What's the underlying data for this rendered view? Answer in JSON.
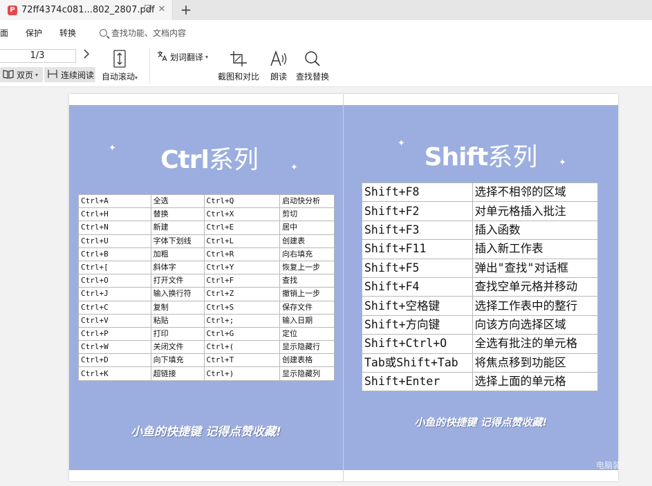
{
  "tab": {
    "title": "72ff4374c081...802_2807.pdf",
    "pdf_badge": "P"
  },
  "menu": {
    "items": [
      "面",
      "保护",
      "转换"
    ],
    "search_placeholder": "查找功能、文档内容"
  },
  "toolbar": {
    "page_value": "1/3",
    "dual_page_label": "双页",
    "continuous_label": "连续阅读",
    "auto_scroll_label": "自动滚动",
    "translate_label": "划词翻译",
    "screenshot_label": "截图和对比",
    "read_aloud_label": "朗读",
    "find_replace_label": "查找替换"
  },
  "left_page": {
    "heading_latin": "Ctrl",
    "heading_cjk": "系列",
    "rows": [
      [
        "Ctrl+A",
        "全选",
        "Ctrl+Q",
        "启动快分析"
      ],
      [
        "Ctrl+H",
        "替换",
        "Ctrl+X",
        "剪切"
      ],
      [
        "Ctrl+N",
        "新建",
        "Ctrl+E",
        "居中"
      ],
      [
        "Ctrl+U",
        "字体下划线",
        "Ctrl+L",
        "创建表"
      ],
      [
        "Ctrl+B",
        "加粗",
        "Ctrl+R",
        "向右填充"
      ],
      [
        "Ctrl+[",
        "斜体字",
        "Ctrl+Y",
        "恢复上一步"
      ],
      [
        "Ctrl+O",
        "打开文件",
        "Ctrl+F",
        "查找"
      ],
      [
        "Ctrl+J",
        "输入换行符",
        "Ctrl+Z",
        "撤销上一步"
      ],
      [
        "Ctrl+C",
        "复制",
        "Ctrl+S",
        "保存文件"
      ],
      [
        "Ctrl+V",
        "粘贴",
        "Ctrl+;",
        "输入日期"
      ],
      [
        "Ctrl+P",
        "打印",
        "Ctrl+G",
        "定位"
      ],
      [
        "Ctrl+W",
        "关闭文件",
        "Ctrl+(",
        "显示隐藏行"
      ],
      [
        "Ctrl+D",
        "向下填充",
        "Ctrl+T",
        "创建表格"
      ],
      [
        "Ctrl+K",
        "超链接",
        "Ctrl+)",
        "显示隐藏列"
      ]
    ],
    "footer": "小鱼的快捷键 记得点赞收藏!"
  },
  "right_page": {
    "heading_latin": "Shift",
    "heading_cjk": "系列",
    "rows": [
      [
        "Shift+F8",
        "选择不相邻的区域"
      ],
      [
        "Shift+F2",
        "对单元格插入批注"
      ],
      [
        "Shift+F3",
        "插入函数"
      ],
      [
        "Shift+F11",
        "插入新工作表"
      ],
      [
        "Shift+F5",
        "弹出\"查找\"对话框"
      ],
      [
        "Shift+F4",
        "查找空单元格并移动"
      ],
      [
        "Shift+空格键",
        "选择工作表中的整行"
      ],
      [
        "Shift+方向键",
        "向该方向选择区域"
      ],
      [
        "Shift+Ctrl+O",
        "全选有批注的单元格"
      ],
      [
        "Tab或Shift+Tab",
        "将焦点移到功能区"
      ],
      [
        "Shift+Enter",
        "选择上面的单元格"
      ]
    ],
    "footer": "小鱼的快捷键 记得点赞收藏!"
  },
  "watermark": "电脑装",
  "colors": {
    "panel_bg": "#9caedf",
    "pdf_red": "#e5484d"
  }
}
